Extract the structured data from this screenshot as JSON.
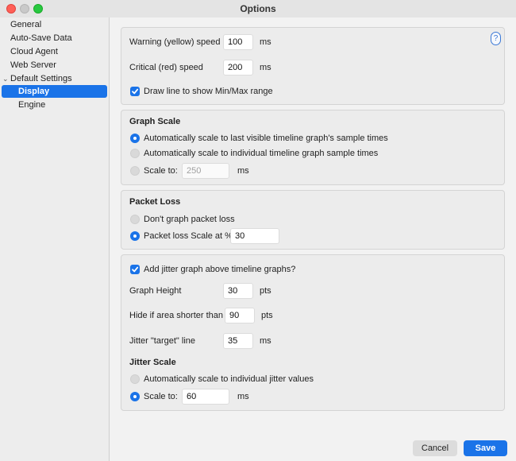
{
  "window": {
    "title": "Options"
  },
  "sidebar": {
    "items": [
      {
        "label": "General"
      },
      {
        "label": "Auto-Save Data"
      },
      {
        "label": "Cloud Agent"
      },
      {
        "label": "Web Server"
      },
      {
        "label": "Default Settings"
      },
      {
        "label": "Display"
      },
      {
        "label": "Engine"
      }
    ]
  },
  "speed": {
    "warning_label": "Warning (yellow) speed",
    "warning_value": "100",
    "warning_unit": "ms",
    "critical_label": "Critical (red) speed",
    "critical_value": "200",
    "critical_unit": "ms",
    "draw_line_label": "Draw line to show Min/Max range",
    "help_glyph": "?"
  },
  "graph_scale": {
    "heading": "Graph Scale",
    "option1": "Automatically scale to last visible timeline graph's sample times",
    "option2": "Automatically scale to individual timeline graph sample times",
    "option3": "Scale to:",
    "scale_value": "250",
    "unit": "ms"
  },
  "packet_loss": {
    "heading": "Packet Loss",
    "option1": "Don't graph packet loss",
    "option2": "Packet loss Scale at %",
    "value": "30"
  },
  "jitter": {
    "add_label": "Add jitter graph above timeline graphs?",
    "height_label": "Graph Height",
    "height_value": "30",
    "height_unit": "pts",
    "hide_label": "Hide if area shorter than",
    "hide_value": "90",
    "hide_unit": "pts",
    "target_label": "Jitter \"target\" line",
    "target_value": "35",
    "target_unit": "ms",
    "scale_heading": "Jitter Scale",
    "scale_option1": "Automatically scale to individual jitter values",
    "scale_option2": "Scale to:",
    "scale_value": "60",
    "scale_unit": "ms"
  },
  "buttons": {
    "cancel": "Cancel",
    "save": "Save"
  },
  "colors": {
    "accent": "#1a73e8",
    "close": "#ff5f57",
    "maximize": "#28c840"
  }
}
